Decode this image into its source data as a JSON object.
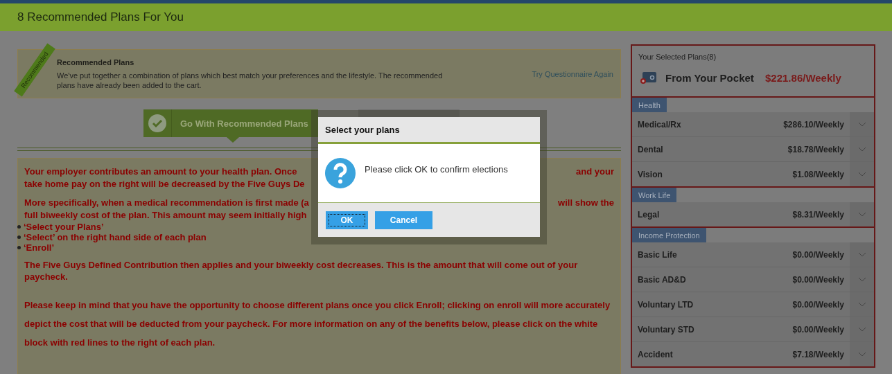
{
  "header": {
    "title": "8 Recommended Plans For You"
  },
  "banner": {
    "ribbon": "Recommended",
    "title": "Recommended Plans",
    "text": "We've put together a combination of plans which best match your preferences and the lifestyle. The recommended plans have already been added to the cart.",
    "link": "Try Questionnaire Again"
  },
  "options": [
    {
      "label": "Go With Recommended Plans",
      "selected": true
    },
    {
      "selected": false
    }
  ],
  "notice": [
    {
      "kind": "split",
      "lines": [
        {
          "text": "Your employer contributes an amount to your health plan.  Once",
          "after": "and your"
        },
        {
          "text": "take home pay on the right will be decreased by the Five Guys De"
        }
      ]
    },
    {
      "kind": "split",
      "lines": [
        {
          "text": "More specifically, when a medical recommendation is first made (a",
          "after": "will show the"
        },
        {
          "text": "full biweekly cost of the plan. This amount may seem initially high"
        }
      ]
    },
    {
      "kind": "bullets",
      "items": [
        "‘Select your Plans’",
        "‘Select’ on the right hand side of each plan",
        "‘Enroll’"
      ]
    },
    {
      "kind": "text",
      "text": "The Five Guys Defined Contribution then applies and your biweekly cost decreases. This is the amount that will come out of your paycheck."
    },
    {
      "kind": "loose",
      "text": "Please keep in mind that you have the opportunity to choose different plans once you click Enroll; clicking on enroll will more accurately depict the cost that will be deducted from your paycheck.  For more information on any of the benefits below, please click on the white block with red lines to the right of each plan."
    }
  ],
  "sidebar": {
    "title": "Your Selected Plans(8)",
    "pocket_label": "From Your Pocket",
    "pocket_amount": "$221.86/Weekly",
    "groups": [
      {
        "name": "Health",
        "plans": [
          {
            "name": "Medical/Rx",
            "cost": "$286.10/Weekly",
            "expanded": false
          },
          {
            "name": "Dental",
            "cost": "$18.78/Weekly",
            "expanded": false
          },
          {
            "name": "Vision",
            "cost": "$1.08/Weekly",
            "expanded": false
          }
        ]
      },
      {
        "name": "Work Life",
        "plans": [
          {
            "name": "Legal",
            "cost": "$8.31/Weekly",
            "expanded": false
          }
        ]
      },
      {
        "name": "Income Protection",
        "plans": [
          {
            "name": "Basic Life",
            "cost": "$0.00/Weekly",
            "expanded": false
          },
          {
            "name": "Basic AD&D",
            "cost": "$0.00/Weekly",
            "expanded": false
          },
          {
            "name": "Voluntary LTD",
            "cost": "$0.00/Weekly",
            "expanded": false
          },
          {
            "name": "Voluntary STD",
            "cost": "$0.00/Weekly",
            "expanded": false
          },
          {
            "name": "Accident",
            "cost": "$7.18/Weekly",
            "expanded": false
          }
        ]
      }
    ]
  },
  "dialog": {
    "title": "Select your plans",
    "message": "Please click OK to confirm elections",
    "buttons": [
      {
        "label": "OK",
        "focused": true
      },
      {
        "label": "Cancel",
        "focused": false
      }
    ]
  }
}
